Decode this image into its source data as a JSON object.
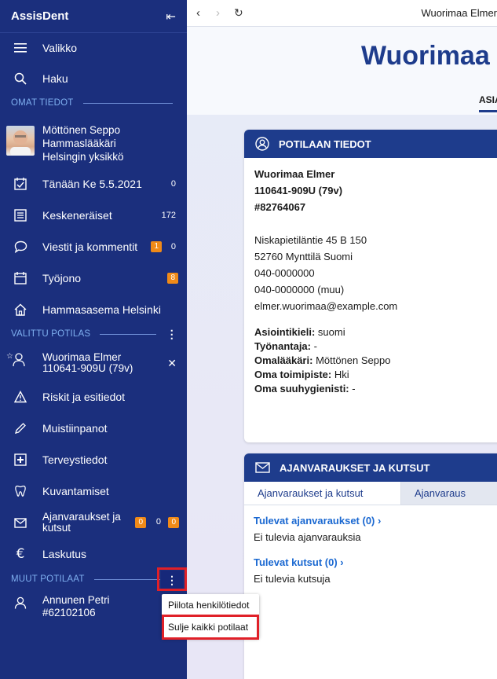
{
  "app": {
    "name": "AssisDent"
  },
  "sidebar": {
    "menu_label": "Valikko",
    "search_label": "Haku",
    "section_own": "OMAT TIEDOT",
    "user": {
      "name": "Möttönen Seppo",
      "role": "Hammaslääkäri",
      "unit": "Helsingin yksikkö"
    },
    "today": {
      "label": "Tänään Ke 5.5.2021",
      "count": "0"
    },
    "unfinished": {
      "label": "Keskeneräiset",
      "count": "172"
    },
    "messages": {
      "label": "Viestit ja kommentit",
      "badge": "1",
      "count": "0"
    },
    "queue": {
      "label": "Työjono",
      "badge": "8"
    },
    "station": {
      "label": "Hammasasema Helsinki"
    },
    "section_selected": "VALITTU POTILAS",
    "selected_patient": {
      "name": "Wuorimaa Elmer",
      "id": "110641-909U (79v)"
    },
    "patient_menu": [
      {
        "label": "Riskit ja esitiedot"
      },
      {
        "label": "Muistiinpanot"
      },
      {
        "label": "Terveystiedot"
      },
      {
        "label": "Kuvantamiset"
      },
      {
        "label": "Ajanvaraukset ja kutsut",
        "badge1": "0",
        "count": "0",
        "badge2": "0"
      },
      {
        "label": "Laskutus"
      }
    ],
    "section_other": "MUUT POTILAAT",
    "other_patient": {
      "name": "Annunen Petri",
      "id": "#62102106"
    }
  },
  "popup": {
    "hide_label": "Piilota henkilötiedot",
    "close_all_label": "Sulje kaikki potilaat"
  },
  "browser": {
    "tab_title": "Wuorimaa Elmer"
  },
  "page": {
    "title": "Wuorimaa",
    "tab": "ASIA"
  },
  "patient_card": {
    "header": "POTILAAN TIEDOT",
    "name": "Wuorimaa Elmer",
    "ssn": "110641-909U (79v)",
    "number": "#82764067",
    "address": "Niskapietiläntie 45 B 150",
    "city": "52760 Mynttilä Suomi",
    "phone1": "040-0000000",
    "phone2": "040-0000000 (muu)",
    "email": "elmer.wuorimaa@example.com",
    "fields": [
      {
        "key": "Asiointikieli:",
        "value": "suomi"
      },
      {
        "key": "Työnantaja:",
        "value": "-"
      },
      {
        "key": "Omalääkäri:",
        "value": "Möttönen Seppo"
      },
      {
        "key": "Oma toimipiste:",
        "value": "Hki"
      },
      {
        "key": "Oma suuhygienisti:",
        "value": "-"
      }
    ]
  },
  "appointments_card": {
    "header": "AJANVARAUKSET JA KUTSUT",
    "tab1": "Ajanvaraukset ja kutsut",
    "tab2": "Ajanvaraus",
    "upcoming_title": "Tulevat ajanvaraukset (0)",
    "upcoming_empty": "Ei tulevia ajanvarauksia",
    "calls_title": "Tulevat kutsut (0)",
    "calls_empty": "Ei tulevia kutsuja"
  },
  "colors": {
    "sidebar": "#1b2f7d",
    "accent": "#1e3c8c",
    "badge": "#f08a18",
    "highlight": "#e02028"
  }
}
